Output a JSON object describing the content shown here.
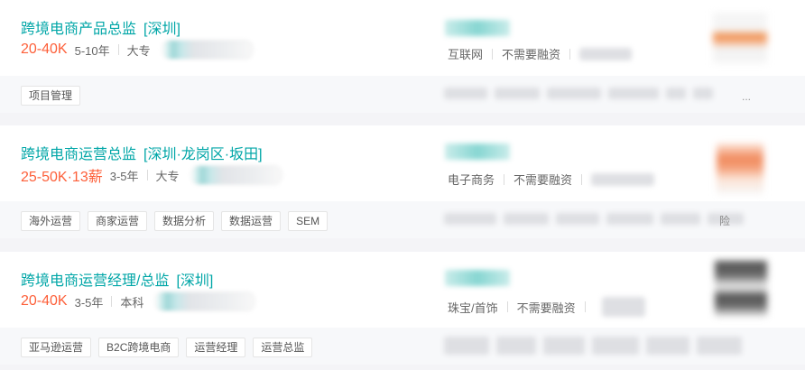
{
  "jobs": [
    {
      "title": "跨境电商产品总监",
      "city": "[深圳]",
      "salary": "20-40K",
      "experience": "5-10年",
      "education": "大专",
      "industry": "互联网",
      "financing": "不需要融资",
      "tags": [
        "项目管理"
      ]
    },
    {
      "title": "跨境电商运营总监",
      "city": "[深圳·龙岗区·坂田]",
      "salary": "25-50K·13薪",
      "experience": "3-5年",
      "education": "大专",
      "industry": "电子商务",
      "financing": "不需要融资",
      "tags": [
        "海外运营",
        "商家运营",
        "数据分析",
        "数据运营",
        "SEM"
      ]
    },
    {
      "title": "跨境电商运营经理/总监",
      "city": "[深圳]",
      "salary": "20-40K",
      "experience": "3-5年",
      "education": "本科",
      "industry": "珠宝/首饰",
      "financing": "不需要融资",
      "tags": [
        "亚马逊运营",
        "B2C跨境电商",
        "运营经理",
        "运营总监"
      ]
    }
  ],
  "more_indicator": "...",
  "welfare_trailing_char": "险",
  "colors": {
    "title": "#00a6a7",
    "salary": "#fd5f39",
    "tag_border": "#e5e5e5"
  }
}
